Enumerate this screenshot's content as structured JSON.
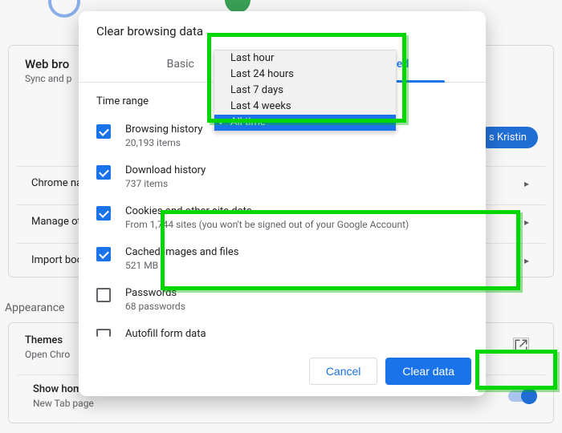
{
  "bg": {
    "section_title": "Web bro",
    "section_sub": "Sync and p",
    "rows": [
      "Chrome na",
      "Manage oth",
      "Import boo"
    ],
    "appearance_label": "Appearance",
    "themes_title": "Themes",
    "themes_sub": "Open Chro",
    "showhome_title": "Show home button",
    "showhome_sub": "New Tab page",
    "pill": "s Kristin"
  },
  "dialog": {
    "title": "Clear browsing data",
    "tabs": {
      "basic": "Basic",
      "advanced": "Advanced"
    },
    "time_label": "Time range",
    "options": [
      "Last hour",
      "Last 24 hours",
      "Last 7 days",
      "Last 4 weeks",
      "All time"
    ],
    "items": [
      {
        "title": "Browsing history",
        "sub": "20,193 items",
        "checked": true
      },
      {
        "title": "Download history",
        "sub": "737 items",
        "checked": true
      },
      {
        "title": "Cookies and other site data",
        "sub": "From 1,744 sites (you won't be signed out of your Google Account)",
        "checked": true
      },
      {
        "title": "Cached images and files",
        "sub": "521 MB",
        "checked": true
      },
      {
        "title": "Passwords",
        "sub": "68 passwords",
        "checked": false
      },
      {
        "title": "Autofill form data",
        "sub": "",
        "checked": false
      }
    ],
    "cancel": "Cancel",
    "clear": "Clear data"
  }
}
